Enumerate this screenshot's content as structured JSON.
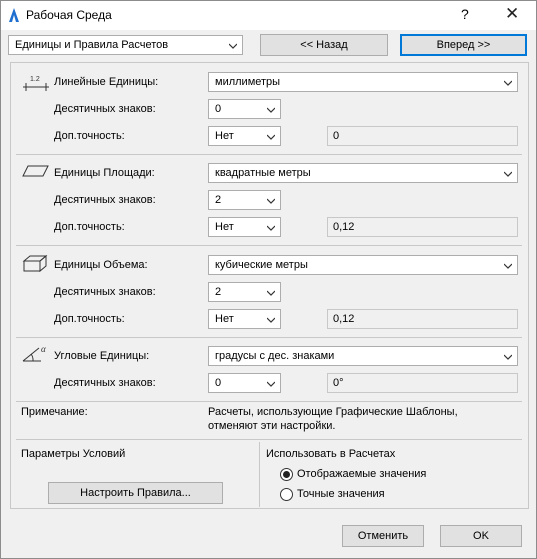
{
  "title": "Рабочая Среда",
  "titlebar": {
    "help": "?",
    "close": "✕"
  },
  "top": {
    "page_select": "Единицы и Правила Расчетов",
    "back": "<< Назад",
    "forward": "Вперед >>"
  },
  "linear": {
    "label": "Линейные Единицы:",
    "unit": "миллиметры",
    "decimals_label": "Десятичных знаков:",
    "decimals": "0",
    "precision_label": "Доп.точность:",
    "precision": "Нет",
    "example": "0"
  },
  "area": {
    "label": "Единицы Площади:",
    "unit": "квадратные метры",
    "decimals_label": "Десятичных знаков:",
    "decimals": "2",
    "precision_label": "Доп.точность:",
    "precision": "Нет",
    "example": "0,12"
  },
  "volume": {
    "label": "Единицы Объема:",
    "unit": "кубические метры",
    "decimals_label": "Десятичных знаков:",
    "decimals": "2",
    "precision_label": "Доп.точность:",
    "precision": "Нет",
    "example": "0,12"
  },
  "angle": {
    "label": "Угловые Единицы:",
    "unit": "градусы с дес. знаками",
    "decimals_label": "Десятичных знаков:",
    "decimals": "0",
    "example": "0°"
  },
  "note": {
    "label": "Примечание:",
    "line1": "Расчеты, использующие Графические Шаблоны,",
    "line2": "отменяют эти настройки."
  },
  "conditions": {
    "label": "Параметры Условий",
    "rules_button": "Настроить Правила..."
  },
  "use_in_calc": {
    "label": "Использовать в Расчетах",
    "options": [
      "Отображаемые значения",
      "Точные значения"
    ],
    "selected": 0
  },
  "footer": {
    "cancel": "Отменить",
    "ok": "OK"
  }
}
